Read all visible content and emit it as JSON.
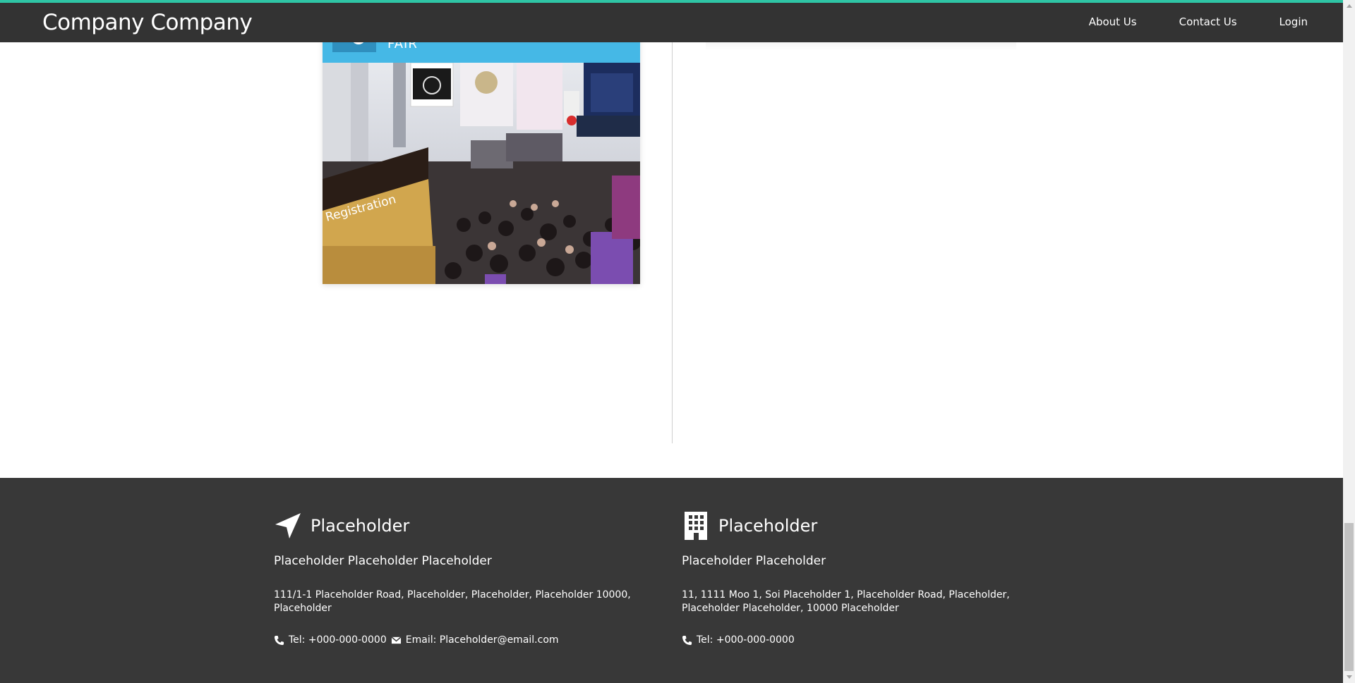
{
  "navbar": {
    "brand": "Company Company",
    "links": [
      "About Us",
      "Contact Us",
      "Login"
    ]
  },
  "card": {
    "header_title": "FAIR",
    "image_alt": "Jewellery fair exhibition hall crowd with Registration counter"
  },
  "footer": {
    "left": {
      "icon": "location-arrow-icon",
      "title": "Placeholder",
      "company": "Placeholder Placeholder Placeholder",
      "address": "111/1-1 Placeholder Road, Placeholder, Placeholder, Placeholder 10000, Placeholder",
      "tel": "Tel: +000-000-0000",
      "email": "Email: Placeholder@email.com"
    },
    "right": {
      "icon": "building-icon",
      "title": "Placeholder",
      "company": "Placeholder Placeholder",
      "address": "11, 1111 Moo 1, Soi Placeholder 1, Placeholder Road, Placeholder, Placeholder Placeholder, 10000 Placeholder",
      "tel": "Tel: +000-000-0000"
    }
  },
  "colors": {
    "accent": "#2fc5a5",
    "navbar": "#333333",
    "card_header": "#45b8e6",
    "footer": "#383838"
  }
}
